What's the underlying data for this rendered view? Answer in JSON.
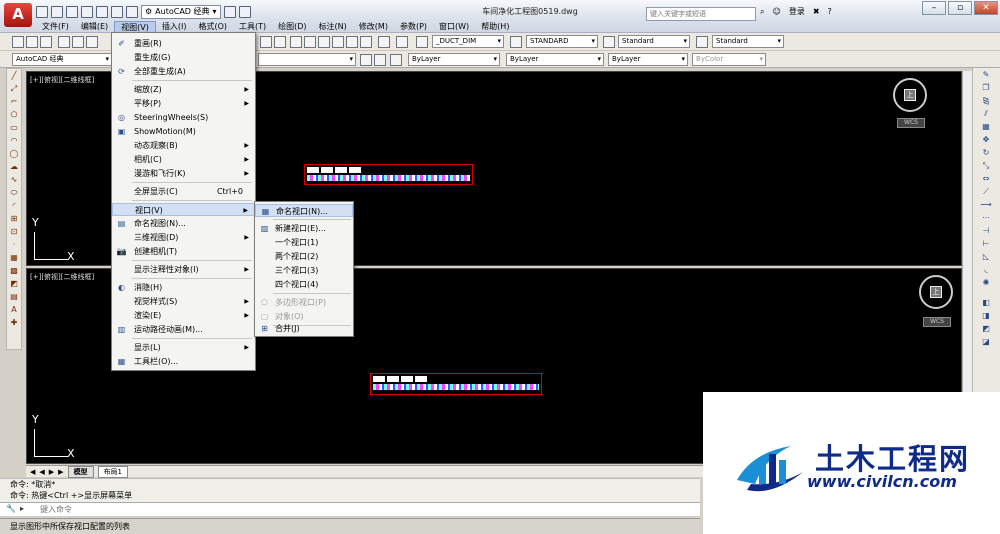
{
  "titlebar": {
    "logo": "A",
    "workspace": "AutoCAD 经典",
    "document_title": "车间净化工程图0519.dwg",
    "search_placeholder": "键入关键字或短语",
    "login": "登录",
    "help": "?"
  },
  "menubar": [
    "文件(F)",
    "编辑(E)",
    "视图(V)",
    "插入(I)",
    "格式(O)",
    "工具(T)",
    "绘图(D)",
    "标注(N)",
    "修改(M)",
    "参数(P)",
    "窗口(W)",
    "帮助(H)"
  ],
  "toolbar1": {
    "dimstyle": "_DUCT_DIM",
    "textstyle": "STANDARD",
    "tablestyle": "Standard",
    "mleaderstyle": "Standard"
  },
  "toolbar2": {
    "workspace": "AutoCAD 经典",
    "color": "ByLayer",
    "linetype": "ByLayer",
    "lineweight": "ByLayer",
    "plotstyle": "ByColor"
  },
  "viewport_top": {
    "label": "[+][俯视][二维线框]",
    "ucs_x": "X",
    "ucs_y": "Y",
    "cube_face": "上",
    "wcs": "WCS"
  },
  "viewport_bottom": {
    "label": "[+][俯视][二维线框]",
    "ucs_x": "X",
    "ucs_y": "Y",
    "cube_face": "上",
    "wcs": "WCS"
  },
  "view_menu": {
    "items": [
      {
        "label": "重画(R)",
        "icon": "brush-icon"
      },
      {
        "label": "重生成(G)"
      },
      {
        "label": "全部重生成(A)",
        "icon": "regen-all-icon"
      },
      {
        "label": "缩放(Z)",
        "submenu": true
      },
      {
        "label": "平移(P)",
        "submenu": true
      },
      {
        "label": "SteeringWheels(S)",
        "icon": "steering-wheel-icon"
      },
      {
        "label": "ShowMotion(M)",
        "icon": "showmotion-icon"
      },
      {
        "label": "动态观察(B)",
        "submenu": true
      },
      {
        "label": "相机(C)",
        "submenu": true
      },
      {
        "label": "漫游和飞行(K)",
        "submenu": true
      },
      {
        "label": "全屏显示(C)",
        "shortcut": "Ctrl+0"
      },
      {
        "label": "视口(V)",
        "submenu": true,
        "highlighted": true
      },
      {
        "label": "命名视图(N)...",
        "icon": "named-view-icon"
      },
      {
        "label": "三维视图(D)",
        "submenu": true
      },
      {
        "label": "创建相机(T)",
        "icon": "camera-icon"
      },
      {
        "label": "显示注释性对象(I)",
        "submenu": true
      },
      {
        "label": "消隐(H)",
        "icon": "hide-icon"
      },
      {
        "label": "视觉样式(S)",
        "submenu": true
      },
      {
        "label": "渲染(E)",
        "submenu": true
      },
      {
        "label": "运动路径动画(M)...",
        "icon": "motion-path-icon"
      },
      {
        "label": "显示(L)",
        "submenu": true
      },
      {
        "label": "工具栏(O)...",
        "icon": "toolbar-icon"
      }
    ]
  },
  "viewports_submenu": {
    "items": [
      {
        "label": "命名视口(N)...",
        "icon": "named-viewport-icon",
        "highlighted": true
      },
      {
        "label": "新建视口(E)...",
        "icon": "new-viewport-icon"
      },
      {
        "label": "一个视口(1)"
      },
      {
        "label": "两个视口(2)"
      },
      {
        "label": "三个视口(3)"
      },
      {
        "label": "四个视口(4)"
      },
      {
        "label": "多边形视口(P)",
        "disabled": true,
        "icon": "polygon-viewport-icon"
      },
      {
        "label": "对象(O)",
        "disabled": true,
        "icon": "object-viewport-icon"
      },
      {
        "label": "合并(J)",
        "icon": "join-viewport-icon"
      }
    ]
  },
  "layout_tabs": {
    "model": "模型",
    "layout1": "布局1"
  },
  "command": {
    "history_1": "命令: *取消*",
    "history_2": "命令: 热键<Ctrl +>显示屏幕菜单",
    "prompt_placeholder": "键入命令"
  },
  "status_text": "显示图形中所保存视口配置的列表",
  "watermark": {
    "cn": "土木工程网",
    "url": "www.civilcn.com"
  },
  "colors": {
    "menu_highlight": "#d3dff2",
    "viewport_bg": "#000000",
    "brand_red": "#c4221a",
    "watermark_blue": "#0f2b8a"
  }
}
